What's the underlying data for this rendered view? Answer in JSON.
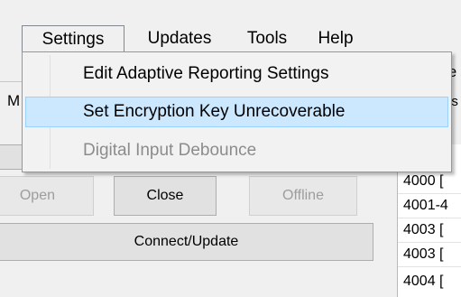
{
  "menubar": {
    "items": [
      {
        "label": "Settings",
        "active": true
      },
      {
        "label": "Updates",
        "active": false
      },
      {
        "label": "Tools",
        "active": false
      },
      {
        "label": "Help",
        "active": false
      }
    ]
  },
  "settings_menu": {
    "items": [
      {
        "label": "Edit Adaptive Reporting Settings",
        "state": "normal"
      },
      {
        "label": "Set Encryption Key Unrecoverable",
        "state": "highlighted"
      },
      {
        "label": "Digital Input Debounce",
        "state": "disabled"
      }
    ]
  },
  "background": {
    "left_fragment": "M",
    "right_header_fragment": "te",
    "right_fragment_2": "es",
    "right_fragment_3": "[",
    "buttons": {
      "open": "Open",
      "close": "Close",
      "offline": "Offline",
      "connect_update": "Connect/Update"
    },
    "list_rows": [
      "4000 [",
      "4001-4",
      "4003 [",
      "4003 [",
      "4004 ["
    ]
  }
}
